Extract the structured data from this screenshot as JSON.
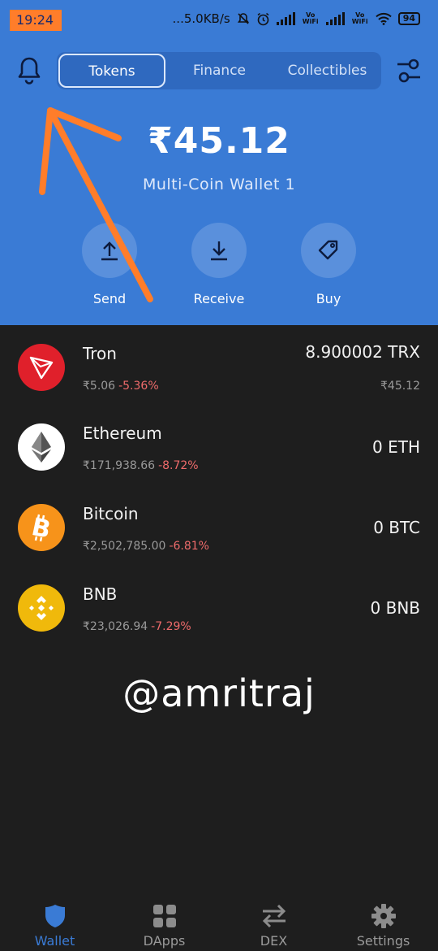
{
  "status_bar": {
    "time": "19:24",
    "net_speed": "...5.0KB/s",
    "vo_wifi_1": "Vo WiFi",
    "vo_wifi_2": "Vo WiFi",
    "battery": "94"
  },
  "header": {
    "tabs": [
      {
        "label": "Tokens",
        "active": true
      },
      {
        "label": "Finance",
        "active": false
      },
      {
        "label": "Collectibles",
        "active": false
      }
    ]
  },
  "wallet": {
    "balance": "₹45.12",
    "name": "Multi-Coin Wallet 1"
  },
  "actions": [
    {
      "label": "Send",
      "icon": "upload-arrow-icon"
    },
    {
      "label": "Receive",
      "icon": "download-arrow-icon"
    },
    {
      "label": "Buy",
      "icon": "tag-icon"
    }
  ],
  "tokens": [
    {
      "name": "Tron",
      "price": "₹5.06",
      "change": "-5.36%",
      "amount": "8.900002 TRX",
      "fiat": "₹45.12",
      "color": "#e0202b",
      "icon": "tron-logo-icon"
    },
    {
      "name": "Ethereum",
      "price": "₹171,938.66",
      "change": "-8.72%",
      "amount": "0 ETH",
      "fiat": "",
      "color": "#ffffff",
      "icon": "ethereum-logo-icon"
    },
    {
      "name": "Bitcoin",
      "price": "₹2,502,785.00",
      "change": "-6.81%",
      "amount": "0 BTC",
      "fiat": "",
      "color": "#f7931a",
      "icon": "bitcoin-logo-icon"
    },
    {
      "name": "BNB",
      "price": "₹23,026.94",
      "change": "-7.29%",
      "amount": "0 BNB",
      "fiat": "",
      "color": "#f0b90b",
      "icon": "bnb-logo-icon"
    }
  ],
  "watermark": "@amritraj",
  "nav": [
    {
      "label": "Wallet",
      "active": true,
      "icon": "shield-icon"
    },
    {
      "label": "DApps",
      "active": false,
      "icon": "grid-icon"
    },
    {
      "label": "DEX",
      "active": false,
      "icon": "swap-arrows-icon"
    },
    {
      "label": "Settings",
      "active": false,
      "icon": "gear-icon"
    }
  ],
  "colors": {
    "accent": "#3a7bd5",
    "background": "#1e1e1e",
    "annotation": "#ff7d2a",
    "negative": "#ef6b6b"
  }
}
